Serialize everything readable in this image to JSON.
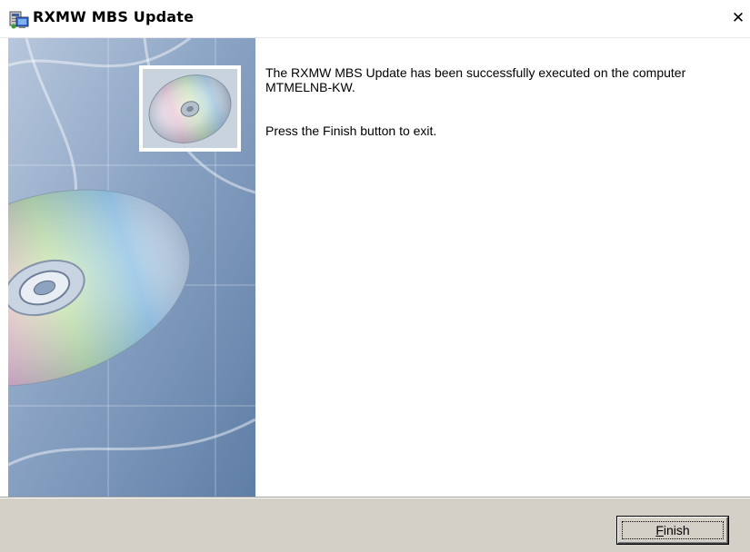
{
  "window": {
    "title": "RXMW MBS Update",
    "title_icon": "setup-computer-icon",
    "close_glyph": "✕",
    "close_icon": "close-icon"
  },
  "content": {
    "message_success": "The RXMW MBS Update has been successfully executed on the computer MTMELNB-KW.",
    "message_instruction": "Press the Finish button to exit."
  },
  "side_panel": {
    "image": "cd-disc-graphic"
  },
  "footer": {
    "finish_accel": "F",
    "finish_rest": "inish"
  },
  "colors": {
    "panel_blue": "#8ea7c6",
    "footer_gray": "#d4d0c8"
  }
}
